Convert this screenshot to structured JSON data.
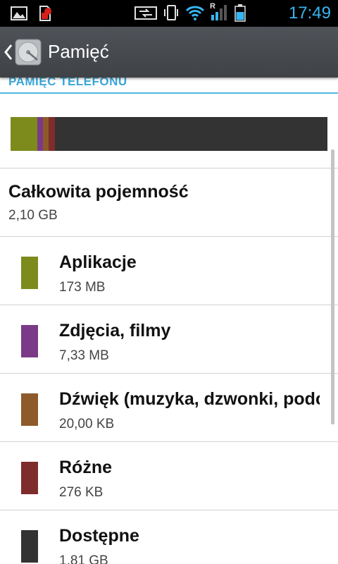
{
  "status_bar": {
    "time": "17:49",
    "network_roaming": "R",
    "icons": [
      "image-icon",
      "sim-alert-icon",
      "data-transfer-icon",
      "vibrate-icon",
      "wifi-icon",
      "signal-icon",
      "battery-icon"
    ]
  },
  "action_bar": {
    "title": "Pamięć",
    "icon": "storage-disk-icon"
  },
  "section": {
    "header": "PAMIĘĆ TELEFONU"
  },
  "total": {
    "label": "Całkowita pojemność",
    "value": "2,10 GB"
  },
  "items": [
    {
      "label": "Aplikacje",
      "value": "173 MB",
      "color": "#7c8b1c"
    },
    {
      "label": "Zdjęcia, filmy",
      "value": "7,33 MB",
      "color": "#7b3a88"
    },
    {
      "label": "Dźwięk (muzyka, dzwonki, podcasty itp.)",
      "value": "20,00 KB",
      "color": "#8e5a2a"
    },
    {
      "label": "Różne",
      "value": "276 KB",
      "color": "#7e2c2c"
    },
    {
      "label": "Dostępne",
      "value": "1,81 GB",
      "color": "#333333"
    }
  ],
  "usage_bar": {
    "segments": [
      {
        "name": "Aplikacje",
        "fraction": 0.085,
        "color": "#7c8b1c"
      },
      {
        "name": "Zdjęcia, filmy",
        "fraction": 0.018,
        "color": "#7b3a88"
      },
      {
        "name": "Dźwięk",
        "fraction": 0.018,
        "color": "#8e5a2a"
      },
      {
        "name": "Różne",
        "fraction": 0.018,
        "color": "#7e2c2c"
      },
      {
        "name": "Dostępne",
        "fraction": 0.861,
        "color": "#333333"
      }
    ]
  },
  "colors": {
    "accent": "#37b6f0",
    "section_header": "#3aa6d6",
    "action_bar": "#46494d"
  }
}
